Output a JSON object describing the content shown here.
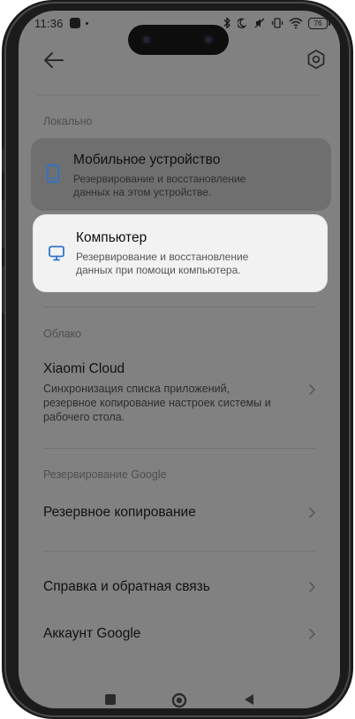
{
  "status_bar": {
    "time": "11:36",
    "battery": "76"
  },
  "sections": {
    "local": {
      "label": "Локально",
      "items": [
        {
          "title": "Мобильное устройство",
          "desc_lines": [
            "Резервирование и восстановление",
            "данных на этом устройстве."
          ]
        },
        {
          "title": "Компьютер",
          "desc_lines": [
            "Резервирование и восстановление",
            "данных при помощи компьютера."
          ]
        }
      ]
    },
    "cloud": {
      "label": "Облако",
      "item": {
        "title": "Xiaomi Cloud",
        "desc_lines": [
          "Синхронизация списка приложений,",
          "резервное копирование настроек системы и",
          "рабочего стола."
        ]
      }
    },
    "google": {
      "label": "Резервирование Google",
      "item": {
        "title": "Резервное копирование"
      }
    }
  },
  "bottom_items": [
    {
      "title": "Справка и обратная связь"
    },
    {
      "title": "Аккаунт Google"
    }
  ],
  "colors": {
    "dim_overlay": "#818181",
    "highlight_card": "#f2f2f2",
    "accent_blue": "#2f73c9"
  }
}
